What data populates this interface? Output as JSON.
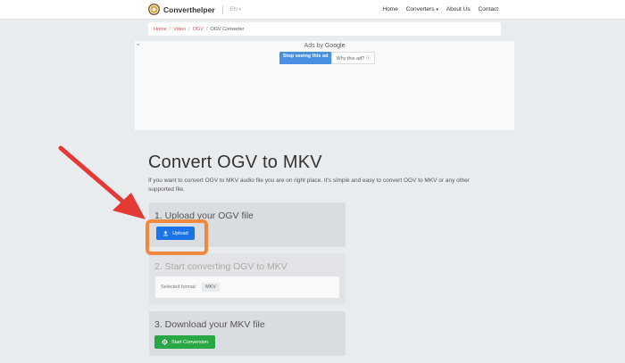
{
  "navbar": {
    "brand": "Converthelper",
    "lang": "EN",
    "links": [
      "Home",
      "Converters",
      "About Us",
      "Contact"
    ]
  },
  "breadcrumb": {
    "items": [
      "Home",
      "Video",
      "OGV"
    ],
    "current": "OGV Converter"
  },
  "ad": {
    "label": "Ads by",
    "google": "Google",
    "stop": "Stop seeing this ad",
    "why": "Why this ad? ⓘ"
  },
  "main": {
    "title": "Convert OGV to MKV",
    "description": "If you want to convert OGV to MKV audio file you are on right place. It's simple and easy to convert OGV to MKV or any other supported file."
  },
  "steps": {
    "step1_title": "1. Upload your OGV file",
    "upload_label": "Upload",
    "step2_title": "2. Start converting OGV to MKV",
    "format_label": "Selected format:",
    "format_value": "MKV",
    "step3_title": "3. Download your MKV file",
    "convert_label": "Start Conversion"
  },
  "colors": {
    "upload": "#1a73e8",
    "convert": "#28a745",
    "highlight": "#f0883e",
    "arrow": "#e53935"
  }
}
